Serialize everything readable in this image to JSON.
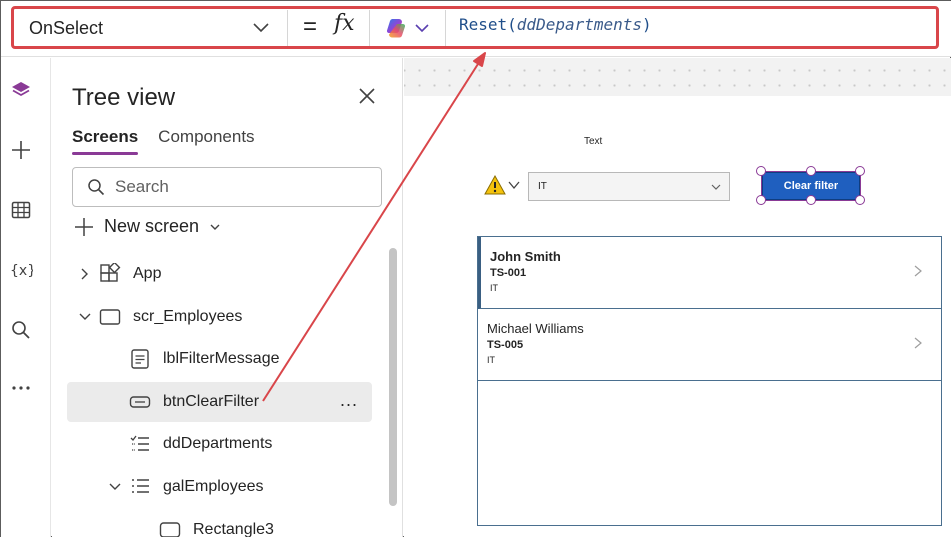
{
  "formula_bar": {
    "property": "OnSelect",
    "equals": "=",
    "fx": "fx",
    "formula_fn": "Reset(",
    "formula_arg": "ddDepartments",
    "formula_close": ")"
  },
  "tree_view": {
    "title": "Tree view",
    "tabs": [
      "Screens",
      "Components"
    ],
    "search_placeholder": "Search",
    "new_screen": "New screen",
    "items": [
      {
        "label": "App",
        "icon": "app-icon"
      },
      {
        "label": "scr_Employees",
        "icon": "screen-icon"
      },
      {
        "label": "lblFilterMessage",
        "icon": "label-icon"
      },
      {
        "label": "btnClearFilter",
        "icon": "button-icon"
      },
      {
        "label": "ddDepartments",
        "icon": "dropdown-icon"
      },
      {
        "label": "galEmployees",
        "icon": "gallery-icon"
      },
      {
        "label": "Rectangle3",
        "icon": "rectangle-icon"
      }
    ],
    "more": "..."
  },
  "canvas": {
    "text_label": "Text",
    "dropdown_value": "IT",
    "button_label": "Clear filter",
    "gallery": [
      {
        "name": "John Smith",
        "id": "TS-001",
        "dept": "IT"
      },
      {
        "name": "Michael Williams",
        "id": "TS-005",
        "dept": "IT"
      }
    ]
  },
  "colors": {
    "highlight": "#d9464a",
    "accent": "#8a3a96",
    "button": "#1f5fbf",
    "formula": "#1f4e8a"
  }
}
